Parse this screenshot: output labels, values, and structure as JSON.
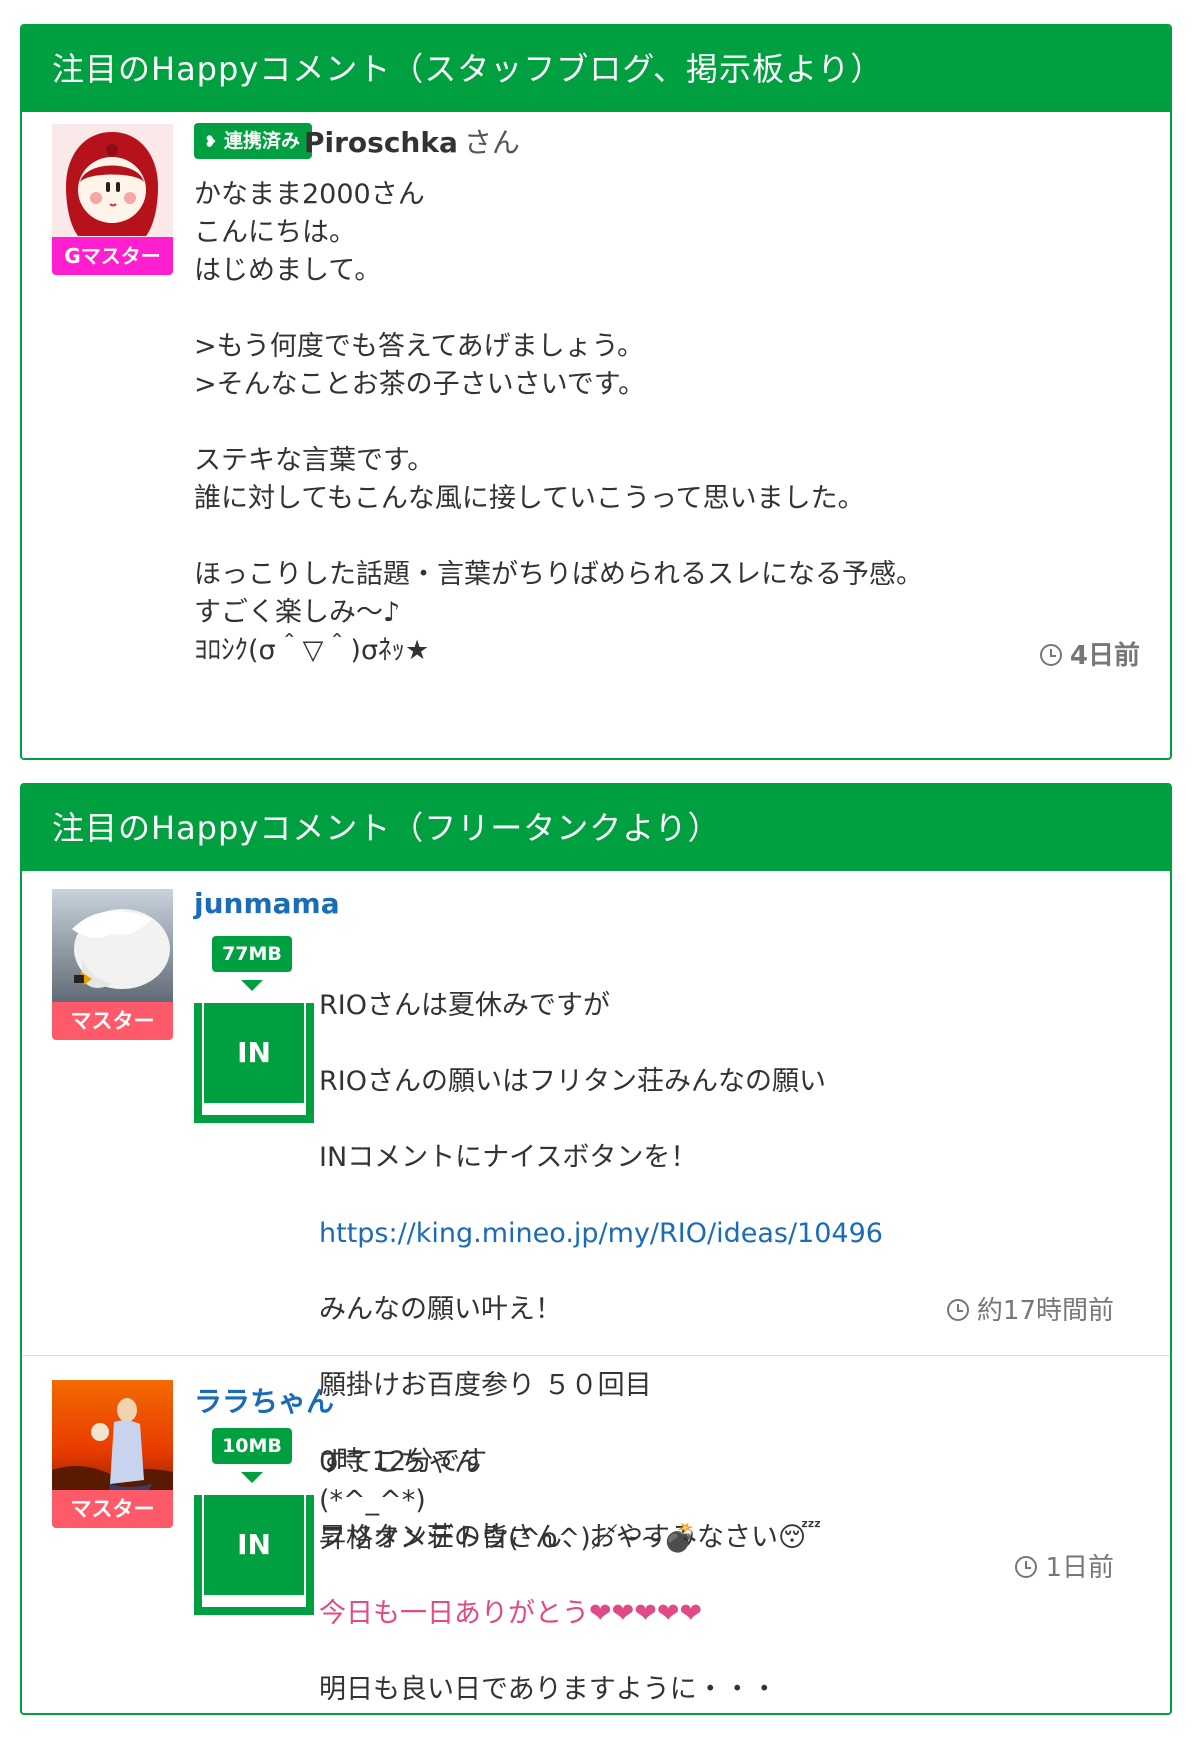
{
  "section1": {
    "title": "注目のHappyコメント（スタッフブログ、掲示板より）",
    "comment": {
      "rank": "Gマスター",
      "linked_badge": "連携済み",
      "user": "Piroschka",
      "honorific": "さん",
      "body": "かなまま2000さん\nこんにちは。\nはじめまして。\n\n>もう何度でも答えてあげましょう。\n>そんなことお茶の子さいさいです。\n\nステキな言葉です。\n誰に対してもこんな風に接していこうって思いました。\n\nほっこりした話題・言葉がちりばめられるスレになる予感。\nすごく楽しみ～♪\nﾖﾛｼｸ(σ＾▽＾)σﾈｯ★",
      "time": "4日前"
    }
  },
  "section2": {
    "title": "注目のHappyコメント（フリータンクより）",
    "comments": [
      {
        "rank": "マスター",
        "user": "junmama",
        "mb": "77MB",
        "in_label": "IN",
        "body_lines": [
          "RIOさんは夏休みですが",
          "RIOさんの願いはフリタン荘みんなの願い",
          "INコメントにナイスボタンを！"
        ],
        "link": "https://king.mineo.jp/my/RIO/ideas/10496",
        "body_lines2": [
          "みんなの願い叶え！",
          "願掛けお百度参り ５０回目",
          "0時 12分です",
          "フリタン荘の皆さん、おやすみなさい😴",
          "今日も一日ありがとう❤❤❤❤❤",
          "明日も良い日でありますように・・・"
        ],
        "time": "約17時間前"
      },
      {
        "rank": "マスター",
        "user": "ララちゃん",
        "mb": "10MB",
        "in_label": "IN",
        "body": "すてこちゃん\n(*^_^*)\n昇格オメデトウ(^o^)／~~💣",
        "time": "1日前"
      }
    ]
  },
  "colors": {
    "brand_green": "#00a040",
    "link_blue": "#1a6bb8",
    "g_master_pink": "#ff1fd0",
    "master_red": "#ff5a6a"
  }
}
